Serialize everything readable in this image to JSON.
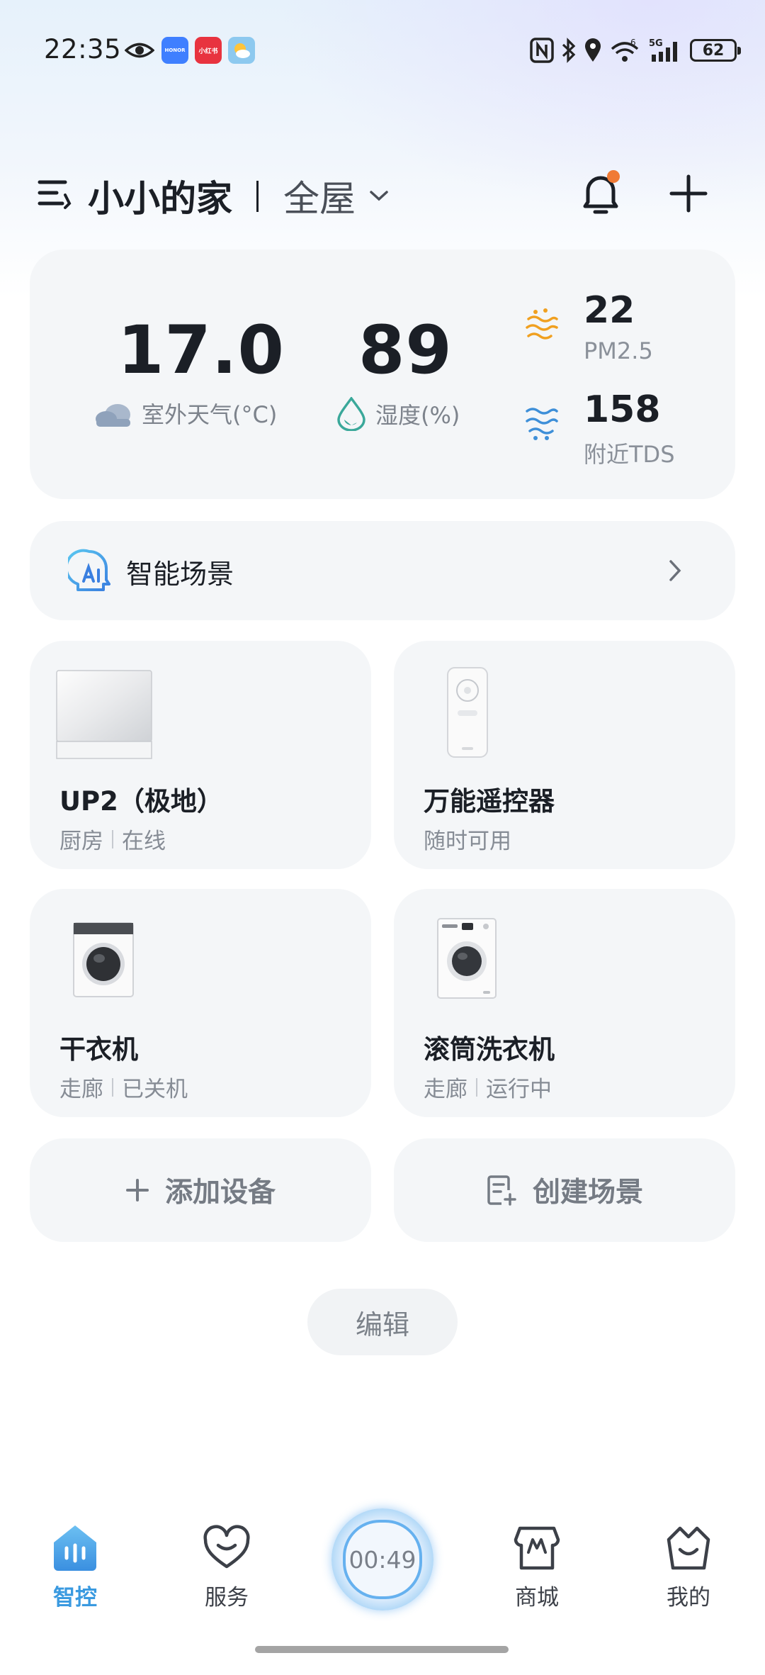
{
  "status_bar": {
    "time": "22:35",
    "honor_icon_text": "HONOR",
    "red_icon_text": "小红书",
    "network": "5G",
    "wifi_badge": "6",
    "battery": "62"
  },
  "header": {
    "home_name": "小小的家",
    "room_scope": "全屋"
  },
  "weather": {
    "temperature": "17.0",
    "temperature_label": "室外天气(°C)",
    "humidity": "89",
    "humidity_label": "湿度(%)",
    "pm25_value": "22",
    "pm25_label": "PM2.5",
    "tds_value": "158",
    "tds_label": "附近TDS"
  },
  "scene": {
    "label": "智能场景"
  },
  "devices": [
    {
      "name": "UP2（极地）",
      "location": "厨房",
      "status": "在线",
      "icon": "water-purifier-image"
    },
    {
      "name": "万能遥控器",
      "status": "随时可用",
      "icon": "remote-control-image"
    },
    {
      "name": "干衣机",
      "location": "走廊",
      "status": "已关机",
      "icon": "dryer-image"
    },
    {
      "name": "滚筒洗衣机",
      "location": "走廊",
      "status": "运行中",
      "icon": "washing-machine-image"
    }
  ],
  "actions": {
    "add_device": "添加设备",
    "create_scene": "创建场景",
    "edit": "编辑"
  },
  "bottom_nav": {
    "items": [
      {
        "label": "智控",
        "icon": "smart-control-icon",
        "active": true
      },
      {
        "label": "服务",
        "icon": "heart-service-icon",
        "active": false
      },
      {
        "label": "商城",
        "icon": "store-icon",
        "active": false
      },
      {
        "label": "我的",
        "icon": "profile-basket-icon",
        "active": false
      }
    ],
    "center_timer": "00:49"
  },
  "colors": {
    "accent": "#3a9ae0",
    "notification_dot": "#f07a35",
    "pm25_icon": "#f0a020",
    "tds_icon": "#3e8fd8",
    "humidity_icon": "#3aa89a"
  }
}
